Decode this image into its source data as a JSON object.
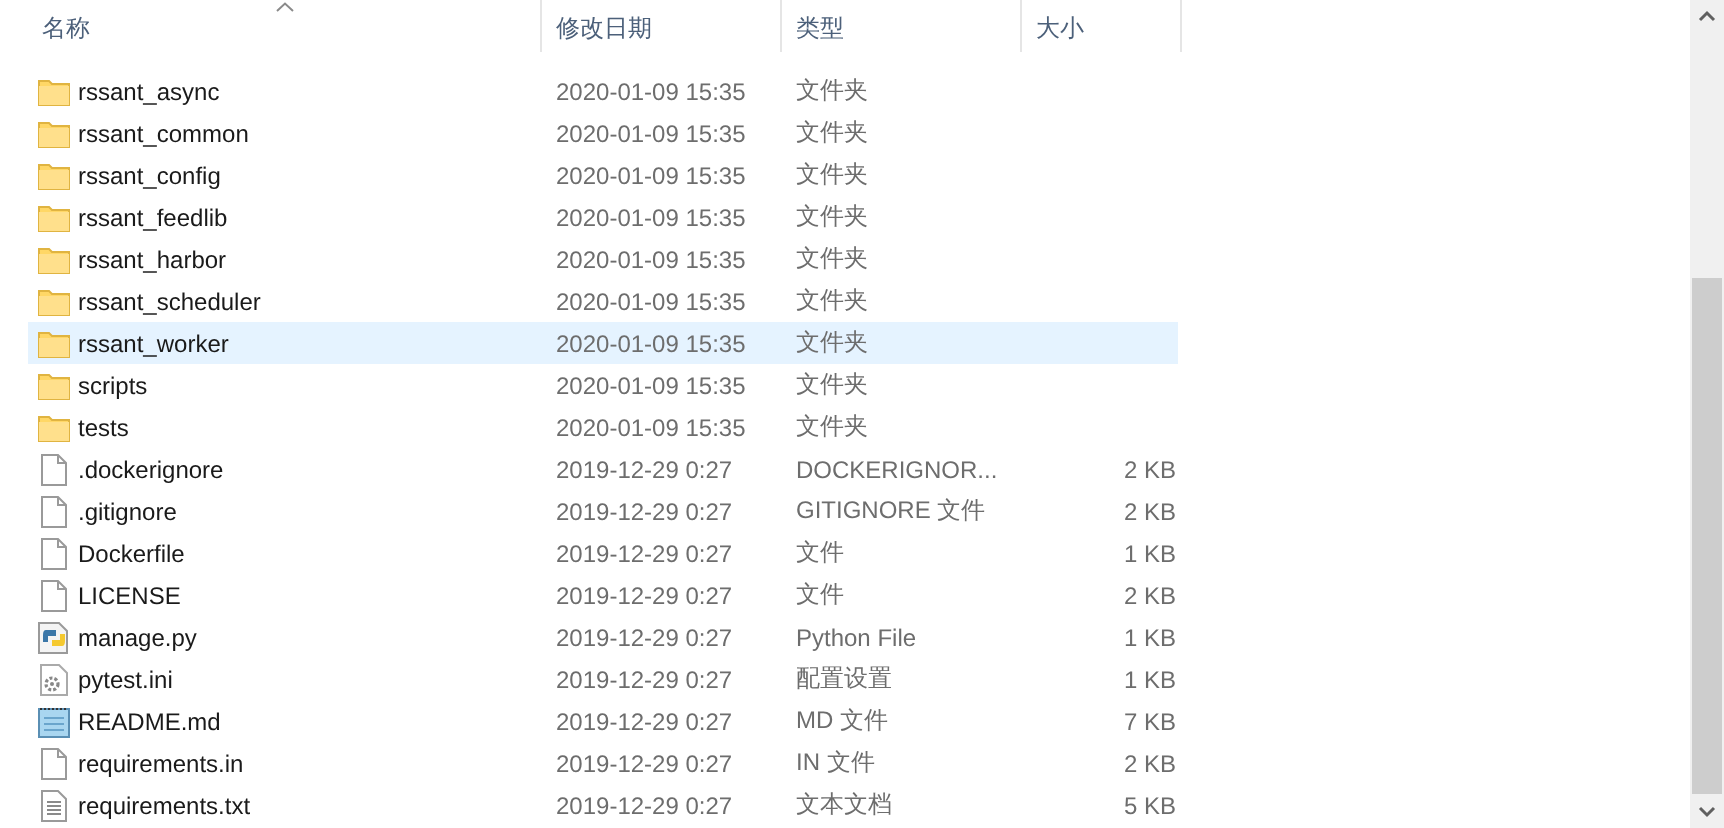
{
  "columns": [
    {
      "label": "名称",
      "sorted": true
    },
    {
      "label": "修改日期",
      "sorted": false
    },
    {
      "label": "类型",
      "sorted": false
    },
    {
      "label": "大小",
      "sorted": false
    }
  ],
  "files": [
    {
      "name": "rssant_async",
      "date": "2020-01-09 15:35",
      "type": "文件夹",
      "kind": "folder",
      "selected": false
    },
    {
      "name": "rssant_common",
      "date": "2020-01-09 15:35",
      "type": "文件夹",
      "kind": "folder",
      "selected": false
    },
    {
      "name": "rssant_config",
      "date": "2020-01-09 15:35",
      "type": "文件夹",
      "kind": "folder",
      "selected": false
    },
    {
      "name": "rssant_feedlib",
      "date": "2020-01-09 15:35",
      "type": "文件夹",
      "kind": "folder",
      "selected": false
    },
    {
      "name": "rssant_harbor",
      "date": "2020-01-09 15:35",
      "type": "文件夹",
      "kind": "folder",
      "selected": false
    },
    {
      "name": "rssant_scheduler",
      "date": "2020-01-09 15:35",
      "type": "文件夹",
      "kind": "folder",
      "selected": false
    },
    {
      "name": "rssant_worker",
      "date": "2020-01-09 15:35",
      "type": "文件夹",
      "kind": "folder",
      "selected": true
    },
    {
      "name": "scripts",
      "date": "2020-01-09 15:35",
      "type": "文件夹",
      "kind": "folder",
      "selected": false
    },
    {
      "name": "tests",
      "date": "2020-01-09 15:35",
      "type": "文件夹",
      "kind": "folder",
      "selected": false
    },
    {
      "name": ".dockerignore",
      "date": "2019-12-29 0:27",
      "type": "DOCKERIGNOR...",
      "size": "2 KB",
      "kind": "file",
      "selected": false
    },
    {
      "name": ".gitignore",
      "date": "2019-12-29 0:27",
      "type": "GITIGNORE 文件",
      "size": "2 KB",
      "kind": "file",
      "selected": false
    },
    {
      "name": "Dockerfile",
      "date": "2019-12-29 0:27",
      "type": "文件",
      "size": "1 KB",
      "kind": "file",
      "selected": false
    },
    {
      "name": "LICENSE",
      "date": "2019-12-29 0:27",
      "type": "文件",
      "size": "2 KB",
      "kind": "file",
      "selected": false
    },
    {
      "name": "manage.py",
      "date": "2019-12-29 0:27",
      "type": "Python File",
      "size": "1 KB",
      "kind": "python",
      "selected": false
    },
    {
      "name": "pytest.ini",
      "date": "2019-12-29 0:27",
      "type": "配置设置",
      "size": "1 KB",
      "kind": "settings",
      "selected": false
    },
    {
      "name": "README.md",
      "date": "2019-12-29 0:27",
      "type": "MD 文件",
      "size": "7 KB",
      "kind": "notepad",
      "selected": false
    },
    {
      "name": "requirements.in",
      "date": "2019-12-29 0:27",
      "type": "IN 文件",
      "size": "2 KB",
      "kind": "file",
      "selected": false
    },
    {
      "name": "requirements.txt",
      "date": "2019-12-29 0:27",
      "type": "文本文档",
      "size": "5 KB",
      "kind": "text",
      "selected": false
    }
  ]
}
